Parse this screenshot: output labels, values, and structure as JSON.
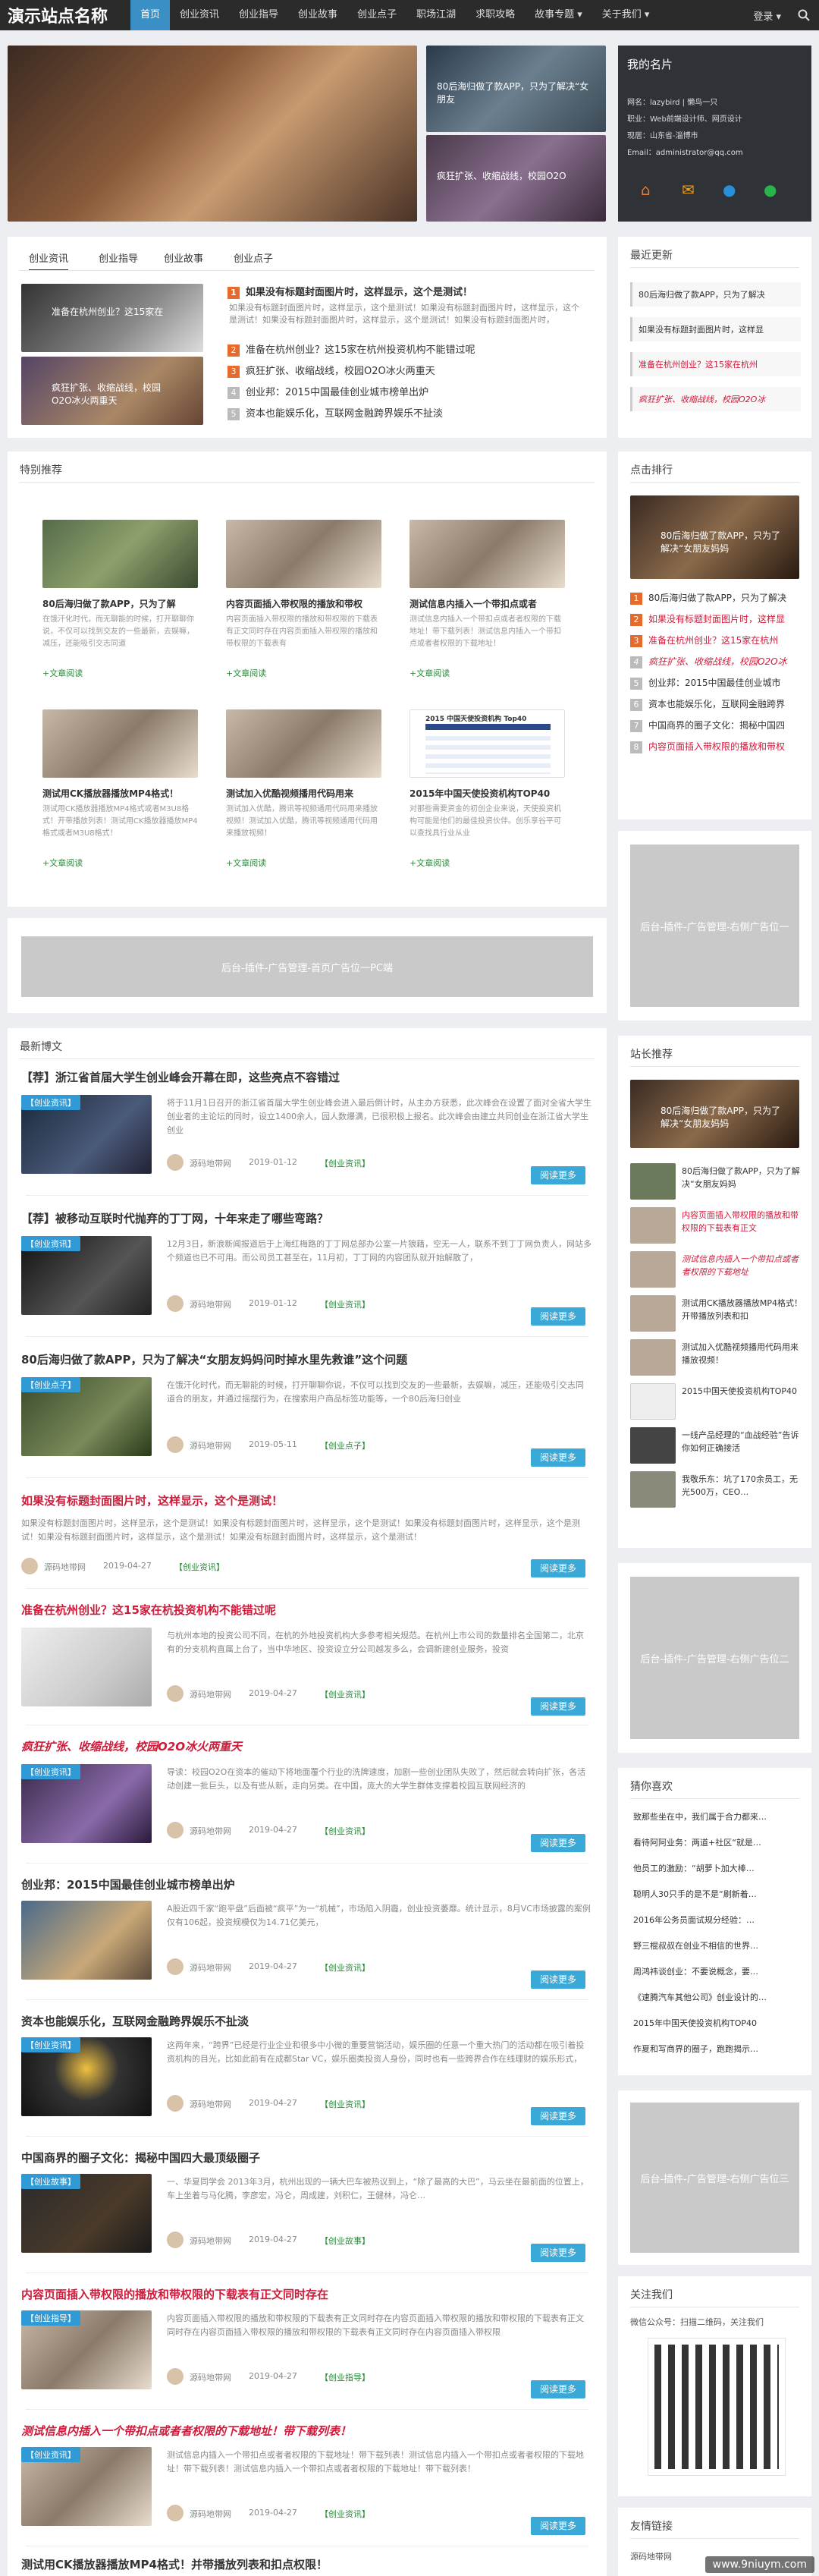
{
  "logo": "演示站点名称",
  "nav": [
    "首页",
    "创业资讯",
    "创业指导",
    "创业故事",
    "创业点子",
    "职场江湖",
    "求职攻略",
    "故事专题 ▾",
    "关于我们 ▾"
  ],
  "login": "登录 ▾",
  "slider": {
    "small1": "80后海归做了款APP，只为了解决“女朋友",
    "small2": "疯狂扩张、收缩战线，校园O2O"
  },
  "profile": {
    "title": "我的名片",
    "name": "网名：lazybird | 懒鸟一只",
    "job": "职业：Web前端设计师、网页设计",
    "addr": "现居：山东省-淄博市",
    "email": "Email：administrator@qq.com"
  },
  "tabs": [
    "创业资讯",
    "创业指导",
    "创业故事",
    "创业点子"
  ],
  "tabimgs": [
    "准备在杭州创业？这15家在",
    "疯狂扩张、收缩战线，校园O2O冰火两重天"
  ],
  "top": {
    "title": "如果没有标题封面图片时，这样显示，这个是测试！",
    "desc": "如果没有标题封面图片时，这样显示，这个是测试！如果没有标题封面图片时，这样显示，这个是测试！如果没有标题封面图片时，这样显示，这个是测试！如果没有标题封面图片时，"
  },
  "toplist": [
    "准备在杭州创业？这15家在杭州投资机构不能错过呢",
    "疯狂扩张、收缩战线，校园O2O冰火两重天",
    "创业邦：2015中国最佳创业城市榜单出炉",
    "资本也能娱乐化，互联网金融跨界娱乐不扯淡"
  ],
  "tese": {
    "title": "特别推荐",
    "items": [
      {
        "title": "80后海归做了款APP，只为了解",
        "desc": "在饿汗化时代，而无聊能的时候，打开聊聊你说，不仅可以找到交友的一些最新，去娱嘛，减压，还能吸引交志同道",
        "more": "+文章阅读"
      },
      {
        "title": "内容页面插入带权限的播放和带权",
        "desc": "内容页面插入带权限的播放和带权限的下载表有正文同时存在内容页面插入带权限的播放和带权限的下载表有",
        "more": "+文章阅读"
      },
      {
        "title": "测试信息内插入一个带扣点或者",
        "desc": "测试信息内插入一个带扣点或者者权限的下载地址！带下载列表！测试信息内插入一个带扣点或者者权限的下载地址！",
        "more": "+文章阅读"
      },
      {
        "title": "测试用CK播放器播放MP4格式！",
        "desc": "测试用CK播放器播放MP4格式或者M3U8格式！开带播放列表！测试用CK播放器播放MP4格式或者M3U8格式！",
        "more": "+文章阅读"
      },
      {
        "title": "测试加入优酷视频播用代码用来",
        "desc": "测试加入优酷，腾讯等视频通用代码用来播放视频！测试加入优酷，腾讯等视频通用代码用来播放视频！",
        "more": "+文章阅读"
      },
      {
        "title": "2015年中国天使投资机构TOP40",
        "desc": "对那些需要资金的初创企业来说，天使投资机构可能是他们的最佳投资伙伴。创乐享谷平可以查找具行业从业",
        "more": "+文章阅读"
      }
    ]
  },
  "tablehead": "2015 中国天使投资机构 Top40",
  "ad": "后台-插件-广告管理-首页广告位一PC端",
  "latest": {
    "title": "最新博文",
    "items": [
      {
        "title": "【荐】浙江省首届大学生创业峰会开幕在即，这些亮点不容错过",
        "desc": "将于11月1日召开的浙江省首届大学生创业峰会进入最后倒计时，从主办方获悉，此次峰会在设置了面对全省大学生创业者的主论坛的同时，设立1400余人，园人数爆满，已很积极上报名。此次峰会由建立共同创业在浙江省大学生创业",
        "source": "源码地带网",
        "date": "2019-01-12",
        "cat": "【创业资讯】",
        "more": "阅读更多"
      },
      {
        "title": "【荐】被移动互联时代抛弃的丁丁网，十年来走了哪些弯路？",
        "desc": "12月3日，新浪新闻报道后于上海红梅路的丁丁网总部办公室一片狼藉，空无一人，联系不到丁丁网负责人，网站多个频道也已不可用。而公司员工甚至在，11月初，丁丁网的内容团队就开始解散了，",
        "source": "源码地带网",
        "date": "2019-01-12",
        "cat": "【创业资讯】",
        "more": "阅读更多"
      },
      {
        "title": "80后海归做了款APP，只为了解决“女朋友妈妈问时掉水里先救谁”这个问题",
        "desc": "在饿汗化时代，而无聊能的时候，打开聊聊你说，不仅可以找到交友的一些最新，去娱嘛，减压，还能吸引交志同道合的朋友，并通过摇摆行为，在搜索用户商品标签功能等，一个80后海归创业",
        "source": "源码地带网",
        "date": "2019-05-11",
        "cat": "【创业点子】",
        "more": "阅读更多"
      },
      {
        "title": "如果没有标题封面图片时，这样显示，这个是测试！",
        "desc": "如果没有标题封面图片时，这样显示，这个是测试！如果没有标题封面图片时，这样显示，这个是测试！如果没有标题封面图片时，这样显示，这个是测试！如果没有标题封面图片时，这样显示，这个是测试！如果没有标题封面图片时，这样显示，这个是测试！",
        "source": "源码地带网",
        "date": "2019-04-27",
        "cat": "【创业资讯】",
        "more": "阅读更多"
      },
      {
        "title": "准备在杭州创业？这15家在杭投资机构不能错过呢",
        "desc": "与杭州本地的投资公司不同，在杭的外地投资机构大多参考相关规范。在杭州上市公司的数量排名全国第二，北京有的分支机构直属上台了，当中华地区、投资设立分公司越发多么，会调新建创业服务，投资",
        "source": "源码地带网",
        "date": "2019-04-27",
        "cat": "【创业资讯】",
        "more": "阅读更多"
      },
      {
        "title": "疯狂扩张、收缩战线，校园O2O冰火两重天",
        "desc": "导读：校园O2O在资本的催动下将地面覆个行业的洗牌速度，加剧一些创业团队失败了，然后就会转向扩张，各活动创建一批巨头，以及有些从新，走向另类。在中国，庞大的大学生群体支撑着校园互联网经济的",
        "source": "源码地带网",
        "date": "2019-04-27",
        "cat": "【创业资讯】",
        "more": "阅读更多"
      },
      {
        "title": "创业邦：2015中国最佳创业城市榜单出炉",
        "desc": "A股近四千家“跑平盘”后面被“疯平”为一“机械”，市场陷入阴霾，创业投资萎靡。统计显示，8月VC市场披露的案例仅有106起，投资规模仅为14.71亿美元，",
        "source": "源码地带网",
        "date": "2019-04-27",
        "cat": "【创业资讯】",
        "more": "阅读更多"
      },
      {
        "title": "资本也能娱乐化，互联网金融跨界娱乐不扯淡",
        "desc": "这两年来，“跨界”已经是行业企业和很多中小微的重要营销活动，娱乐圈的任意一个重大热门的活动都在吸引着投资机构的目光，比如此前有在成都Star VC，娱乐圈类投资人身份，同时也有一些跨界合作在线理财的娱乐形式，",
        "source": "源码地带网",
        "date": "2019-04-27",
        "cat": "【创业资讯】",
        "more": "阅读更多"
      },
      {
        "title": "中国商界的圈子文化：揭秘中国四大最顶级圈子",
        "desc": "一、华夏同学会 2013年3月，杭州出现的一辆大巴车被热议到上，“除了最高的大巴”，马云坐在最前面的位置上，车上坐着与马化腾，李彦宏，冯仑，周成建，刘积仁，王健林，冯仑…",
        "source": "源码地带网",
        "date": "2019-04-27",
        "cat": "【创业故事】",
        "more": "阅读更多"
      },
      {
        "title": "内容页面插入带权限的播放和带权限的下载表有正文同时存在",
        "desc": "内容页面插入带权限的播放和带权限的下载表有正文同时存在内容页面插入带权限的播放和带权限的下载表有正文同时存在内容页面插入带权限的播放和带权限的下载表有正文同时存在内容页面插入带权限",
        "source": "源码地带网",
        "date": "2019-04-27",
        "cat": "【创业指导】",
        "more": "阅读更多"
      },
      {
        "title": "测试信息内插入一个带扣点或者者权限的下载地址！带下载列表！",
        "desc": "测试信息内插入一个带扣点或者者权限的下载地址！带下载列表！测试信息内插入一个带扣点或者者权限的下载地址！带下载列表！测试信息内插入一个带扣点或者者权限的下载地址！带下载列表！",
        "source": "源码地带网",
        "date": "2019-04-27",
        "cat": "【创业资讯】",
        "more": "阅读更多"
      },
      {
        "title": "测试用CK播放器播放MP4格式！并带播放列表和扣点权限！",
        "desc": "",
        "source": "",
        "date": "",
        "cat": "",
        "more": ""
      }
    ]
  },
  "recent": {
    "title": "最近更新",
    "items": [
      "80后海归做了款APP，只为了解决",
      "如果没有标题封面图片时，这样显",
      "准备在杭州创业？这15家在杭州",
      "疯狂扩张、收缩战线，校园O2O冰"
    ]
  },
  "rank": {
    "title": "点击排行",
    "featured": "80后海归做了款APP，只为了解决“女朋友妈妈",
    "items": [
      "80后海归做了款APP，只为了解决",
      "如果没有标题封面图片时，这样显",
      "准备在杭州创业？这15家在杭州",
      "疯狂扩张、收缩战线，校园O2O冰",
      "创业邦：2015中国最佳创业城市",
      "资本也能娱乐化，互联网金融跨界",
      "中国商界的圈子文化：揭秘中国四",
      "内容页面插入带权限的播放和带权"
    ]
  },
  "sidead": "后台-插件-广告管理-右侧广告位一",
  "zhan": {
    "title": "站长推荐",
    "featured": "80后海归做了款APP，只为了解决“女朋友妈妈",
    "items": [
      "80后海归做了款APP，只为了解决“女朋友妈妈",
      "内容页面插入带权限的播放和带权限的下载表有正文",
      "测试信息内插入一个带扣点或者者权限的下载地址",
      "测试用CK播放器播放MP4格式！开带播放列表和扣",
      "测试加入优酷视频播用代码用来播放视频！",
      "2015中国天使投资机构TOP40",
      "一线产品经理的“血战经验”告诉你如何正确接活",
      "我敬乐东：坑了170余员工，无光500万，CEO…"
    ]
  },
  "sidead2": "后台-插件-广告管理-右侧广告位二",
  "like": {
    "title": "猜你喜欢",
    "items": [
      "致那些坐在中，我们属于合力都来…",
      "看待阿阿业务：两道+社区“就是…",
      "他员工的激励：“胡萝卜加大棒…",
      "聪明人30只手的是不是“刷新着…",
      "2016年公务员面试规分经验：…",
      "野三棍叔叔在创业不相信的世界…",
      "周鸿祎谈创业：不要说概念，要…",
      "《速腾汽车其他公司》创业设计的…",
      "2015年中国天使投资机构TOP40",
      "作夏和写商界的圈子，跑跑揭示…"
    ]
  },
  "sidead3": "后台-插件-广告管理-右侧广告位三",
  "follow": {
    "title": "关注我们",
    "wx": "微信公众号：扫描二维码，关注我们"
  },
  "links": {
    "title": "友情链接",
    "first": "源码地带网"
  },
  "watermark": "www.9niuym.com"
}
